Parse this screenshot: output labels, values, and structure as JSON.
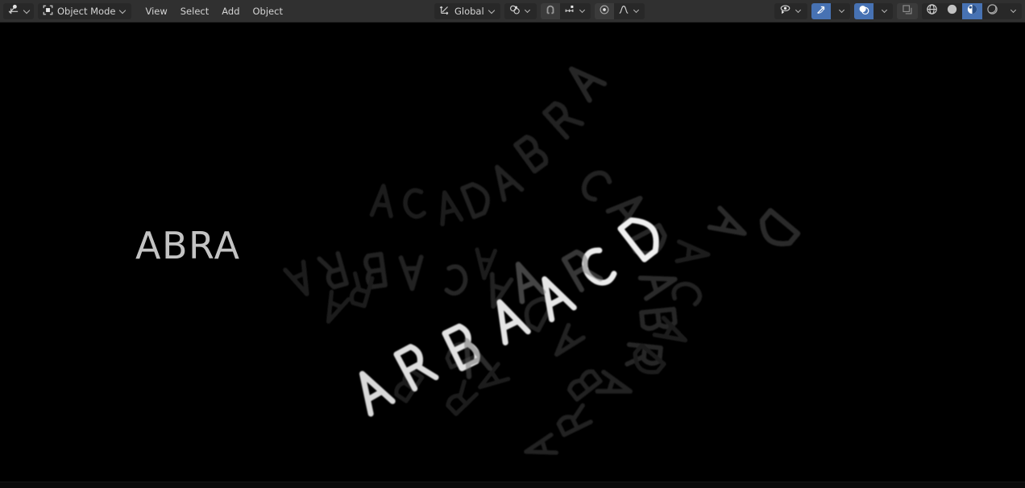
{
  "header": {
    "editor_type_icon": "editor-type-3d-viewport-icon",
    "mode": {
      "label": "Object Mode",
      "icon": "object-mode-icon"
    },
    "menus": [
      {
        "label": "View"
      },
      {
        "label": "Select"
      },
      {
        "label": "Add"
      },
      {
        "label": "Object"
      }
    ],
    "transform_orientation": {
      "label": "Global",
      "icon": "transform-orientation-icon"
    },
    "pivot_point": {
      "icon": "pivot-point-icon"
    },
    "snapping": {
      "magnet_icon": "snap-magnet-icon",
      "magnet_enabled": true,
      "snap_to_icon": "snap-to-increment-icon"
    },
    "proportional_editing": {
      "icon": "proportional-editing-icon",
      "falloff_icon": "proportional-falloff-smooth-icon",
      "enabled": false
    },
    "visibility": {
      "icon": "object-visibility-icon"
    },
    "gizmos": {
      "icon": "gizmo-icon",
      "enabled": true
    },
    "overlays": {
      "icon": "overlays-icon",
      "enabled": true
    },
    "xray": {
      "icon": "toggle-xray-icon",
      "enabled": false
    },
    "shading": {
      "modes": [
        {
          "icon": "shading-wireframe-icon",
          "active": false
        },
        {
          "icon": "shading-solid-icon",
          "active": false
        },
        {
          "icon": "shading-material-preview-icon",
          "active": true
        },
        {
          "icon": "shading-rendered-icon",
          "active": false
        }
      ],
      "dropdown_icon": "shading-options-chevron-icon"
    }
  },
  "viewport": {
    "label_text": "ABRA",
    "background_color": "#000000",
    "object_word": "ABRACADABRA",
    "object_name": "abracadabra-text-helix"
  },
  "colors": {
    "header_bg": "#303030",
    "button_bg": "#282828",
    "accent_blue": "#4772b3",
    "text": "#d4d4d4",
    "viewport_bg": "#000000",
    "text_object_light": "#d9d9d9",
    "text_object_dark": "#242424"
  }
}
